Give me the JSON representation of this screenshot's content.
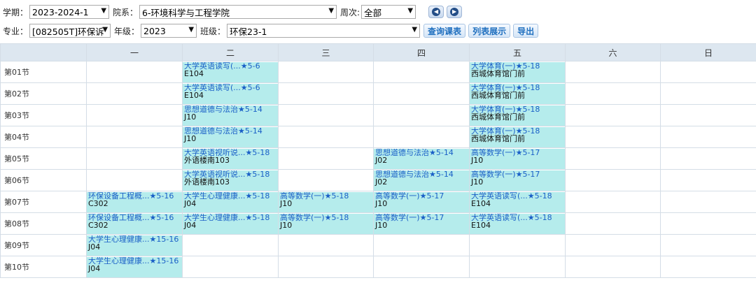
{
  "toolbar": {
    "term_label": "学期：",
    "term_value": "2023-2024-1",
    "dept_label": "院系：",
    "dept_value": "6-环境科学与工程学院",
    "week_label": "周次:",
    "week_value": "全部",
    "major_label": "专业：",
    "major_value": "[082505T]环保诉",
    "grade_label": "年级：",
    "grade_value": "2023",
    "class_label": "班级：",
    "class_value": "环保23-1",
    "query_btn": "查询课表",
    "list_btn": "列表展示",
    "export_btn": "导出",
    "prev_icon": "chevron-left-icon",
    "next_icon": "chevron-right-icon"
  },
  "grid": {
    "days": [
      "一",
      "二",
      "三",
      "四",
      "五",
      "六",
      "日"
    ],
    "periods": [
      {
        "label": "第01节",
        "cells": [
          null,
          {
            "title": "大学英语读写(...★5-6",
            "room": "E104"
          },
          null,
          null,
          {
            "title": "大学体育(一)★5-18",
            "room": "西城体育馆门前"
          },
          null,
          null
        ]
      },
      {
        "label": "第02节",
        "cells": [
          null,
          {
            "title": "大学英语读写(...★5-6",
            "room": "E104"
          },
          null,
          null,
          {
            "title": "大学体育(一)★5-18",
            "room": "西城体育馆门前"
          },
          null,
          null
        ]
      },
      {
        "label": "第03节",
        "cells": [
          null,
          {
            "title": "思想道德与法治★5-14",
            "room": "J10"
          },
          null,
          null,
          {
            "title": "大学体育(一)★5-18",
            "room": "西城体育馆门前"
          },
          null,
          null
        ]
      },
      {
        "label": "第04节",
        "cells": [
          null,
          {
            "title": "思想道德与法治★5-14",
            "room": "J10"
          },
          null,
          null,
          {
            "title": "大学体育(一)★5-18",
            "room": "西城体育馆门前"
          },
          null,
          null
        ]
      },
      {
        "label": "第05节",
        "cells": [
          null,
          {
            "title": "大学英语视听说...★5-18",
            "room": "外语楼南103"
          },
          null,
          {
            "title": "思想道德与法治★5-14",
            "room": "J02"
          },
          {
            "title": "高等数学(一)★5-17",
            "room": "J10"
          },
          null,
          null
        ]
      },
      {
        "label": "第06节",
        "cells": [
          null,
          {
            "title": "大学英语视听说...★5-18",
            "room": "外语楼南103"
          },
          null,
          {
            "title": "思想道德与法治★5-14",
            "room": "J02"
          },
          {
            "title": "高等数学(一)★5-17",
            "room": "J10"
          },
          null,
          null
        ]
      },
      {
        "label": "第07节",
        "cells": [
          {
            "title": "环保设备工程概...★5-16",
            "room": "C302"
          },
          {
            "title": "大学生心理健康...★5-18",
            "room": "J04"
          },
          {
            "title": "高等数学(一)★5-18",
            "room": "J10"
          },
          {
            "title": "高等数学(一)★5-17",
            "room": "J10"
          },
          {
            "title": "大学英语读写(...★5-18",
            "room": "E104"
          },
          null,
          null
        ]
      },
      {
        "label": "第08节",
        "cells": [
          {
            "title": "环保设备工程概...★5-16",
            "room": "C302"
          },
          {
            "title": "大学生心理健康...★5-18",
            "room": "J04"
          },
          {
            "title": "高等数学(一)★5-18",
            "room": "J10"
          },
          {
            "title": "高等数学(一)★5-17",
            "room": "J10"
          },
          {
            "title": "大学英语读写(...★5-18",
            "room": "E104"
          },
          null,
          null
        ]
      },
      {
        "label": "第09节",
        "cells": [
          {
            "title": "大学生心理健康...★15-16",
            "room": "J04"
          },
          null,
          null,
          null,
          null,
          null,
          null
        ]
      },
      {
        "label": "第10节",
        "cells": [
          {
            "title": "大学生心理健康...★15-16",
            "room": "J04"
          },
          null,
          null,
          null,
          null,
          null,
          null
        ]
      }
    ]
  },
  "colors": {
    "course_bg": "#b5ecec",
    "course_title": "#1a5fc7",
    "header_bg": "#dde7f0",
    "button_text": "#1f6fbf"
  }
}
